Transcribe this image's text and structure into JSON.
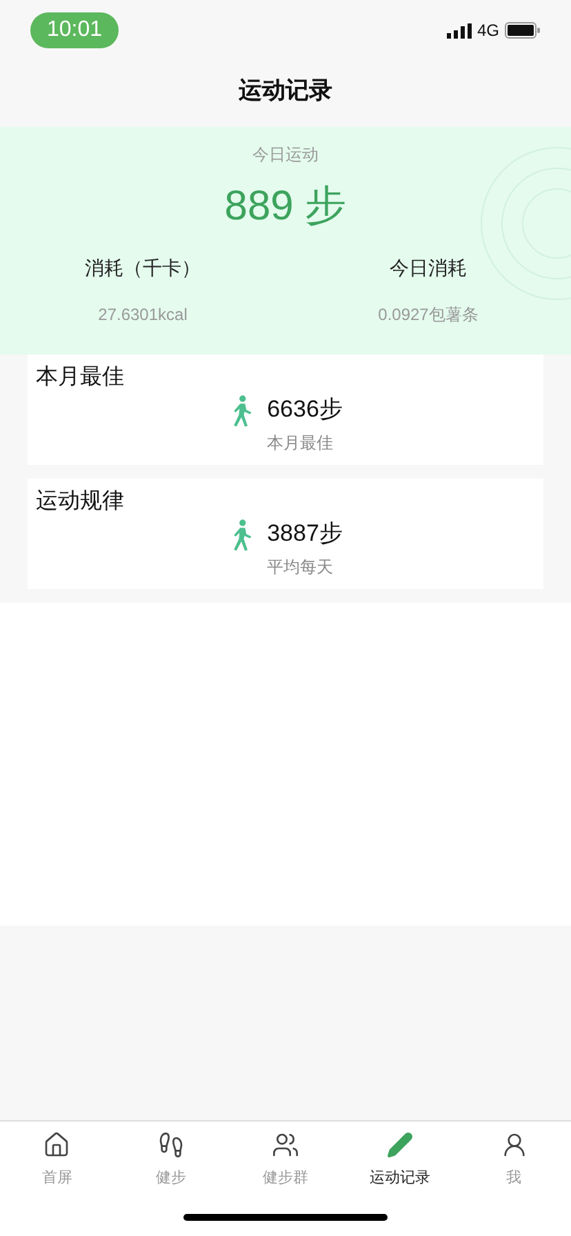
{
  "status_bar": {
    "time": "10:01",
    "network": "4G"
  },
  "header": {
    "title": "运动记录"
  },
  "today": {
    "label": "今日运动",
    "steps": "889 步",
    "stats": [
      {
        "label": "消耗（千卡）",
        "value": "27.6301kcal"
      },
      {
        "label": "今日消耗",
        "value": "0.0927包薯条"
      }
    ]
  },
  "cards": [
    {
      "title": "本月最佳",
      "steps": "6636步",
      "caption": "本月最佳"
    },
    {
      "title": "运动规律",
      "steps": "3887步",
      "caption": "平均每天"
    }
  ],
  "tab_bar": [
    {
      "kind": "home",
      "label": "首屏",
      "selected": false
    },
    {
      "kind": "walk",
      "label": "健步",
      "selected": false
    },
    {
      "kind": "group",
      "label": "健步群",
      "selected": false
    },
    {
      "kind": "record",
      "label": "运动记录",
      "selected": true
    },
    {
      "kind": "me",
      "label": "我",
      "selected": false
    }
  ]
}
